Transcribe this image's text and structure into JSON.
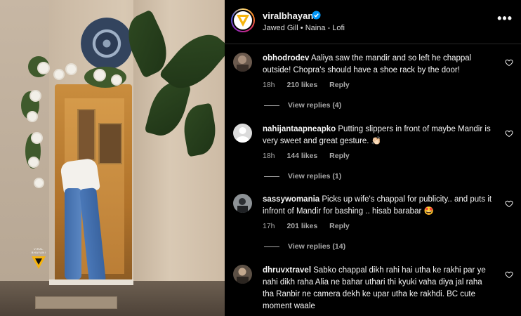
{
  "post": {
    "username": "viralbhayani",
    "subtitle": "Jawed Gill • Naina - Lofi",
    "more_label": "•••"
  },
  "photo": {
    "watermark_text": "VIRAL BHAYANI"
  },
  "comments": [
    {
      "username": "obhodrodev",
      "text": "Aaliya saw the mandir and so left he chappal outside! Chopra's should have a shoe rack by the door!",
      "time": "18h",
      "likes": "210 likes",
      "reply": "Reply",
      "view_replies": "View replies (4)"
    },
    {
      "username": "nahijantaapneapko",
      "text": "Putting slippers in front of maybe Mandir is very sweet and great gesture. 👏🏻",
      "time": "18h",
      "likes": "144 likes",
      "reply": "Reply",
      "view_replies": "View replies (1)"
    },
    {
      "username": "sassywomania",
      "text": "Picks up wife's chappal for publicity.. and puts it infront of Mandir for bashing .. hisab barabar 🤩",
      "time": "17h",
      "likes": "201 likes",
      "reply": "Reply",
      "view_replies": "View replies (14)"
    },
    {
      "username": "dhruvxtravel",
      "text": "Sabko chappal dikh rahi hai utha ke rakhi par ye nahi dikh raha Alia ne bahar uthari thi kyuki vaha diya jal raha tha Ranbir ne camera dekh ke upar utha ke rakhdi. BC cute moment waale"
    }
  ],
  "colors": {
    "background": "#000000",
    "text_primary": "#f5f5f5",
    "text_secondary": "#a8a8a8",
    "verified_blue": "#0095f6",
    "logo_yellow": "#f6b40e"
  },
  "icons": [
    "verified-icon",
    "more-options-icon",
    "heart-icon",
    "brand-logo-icon"
  ]
}
